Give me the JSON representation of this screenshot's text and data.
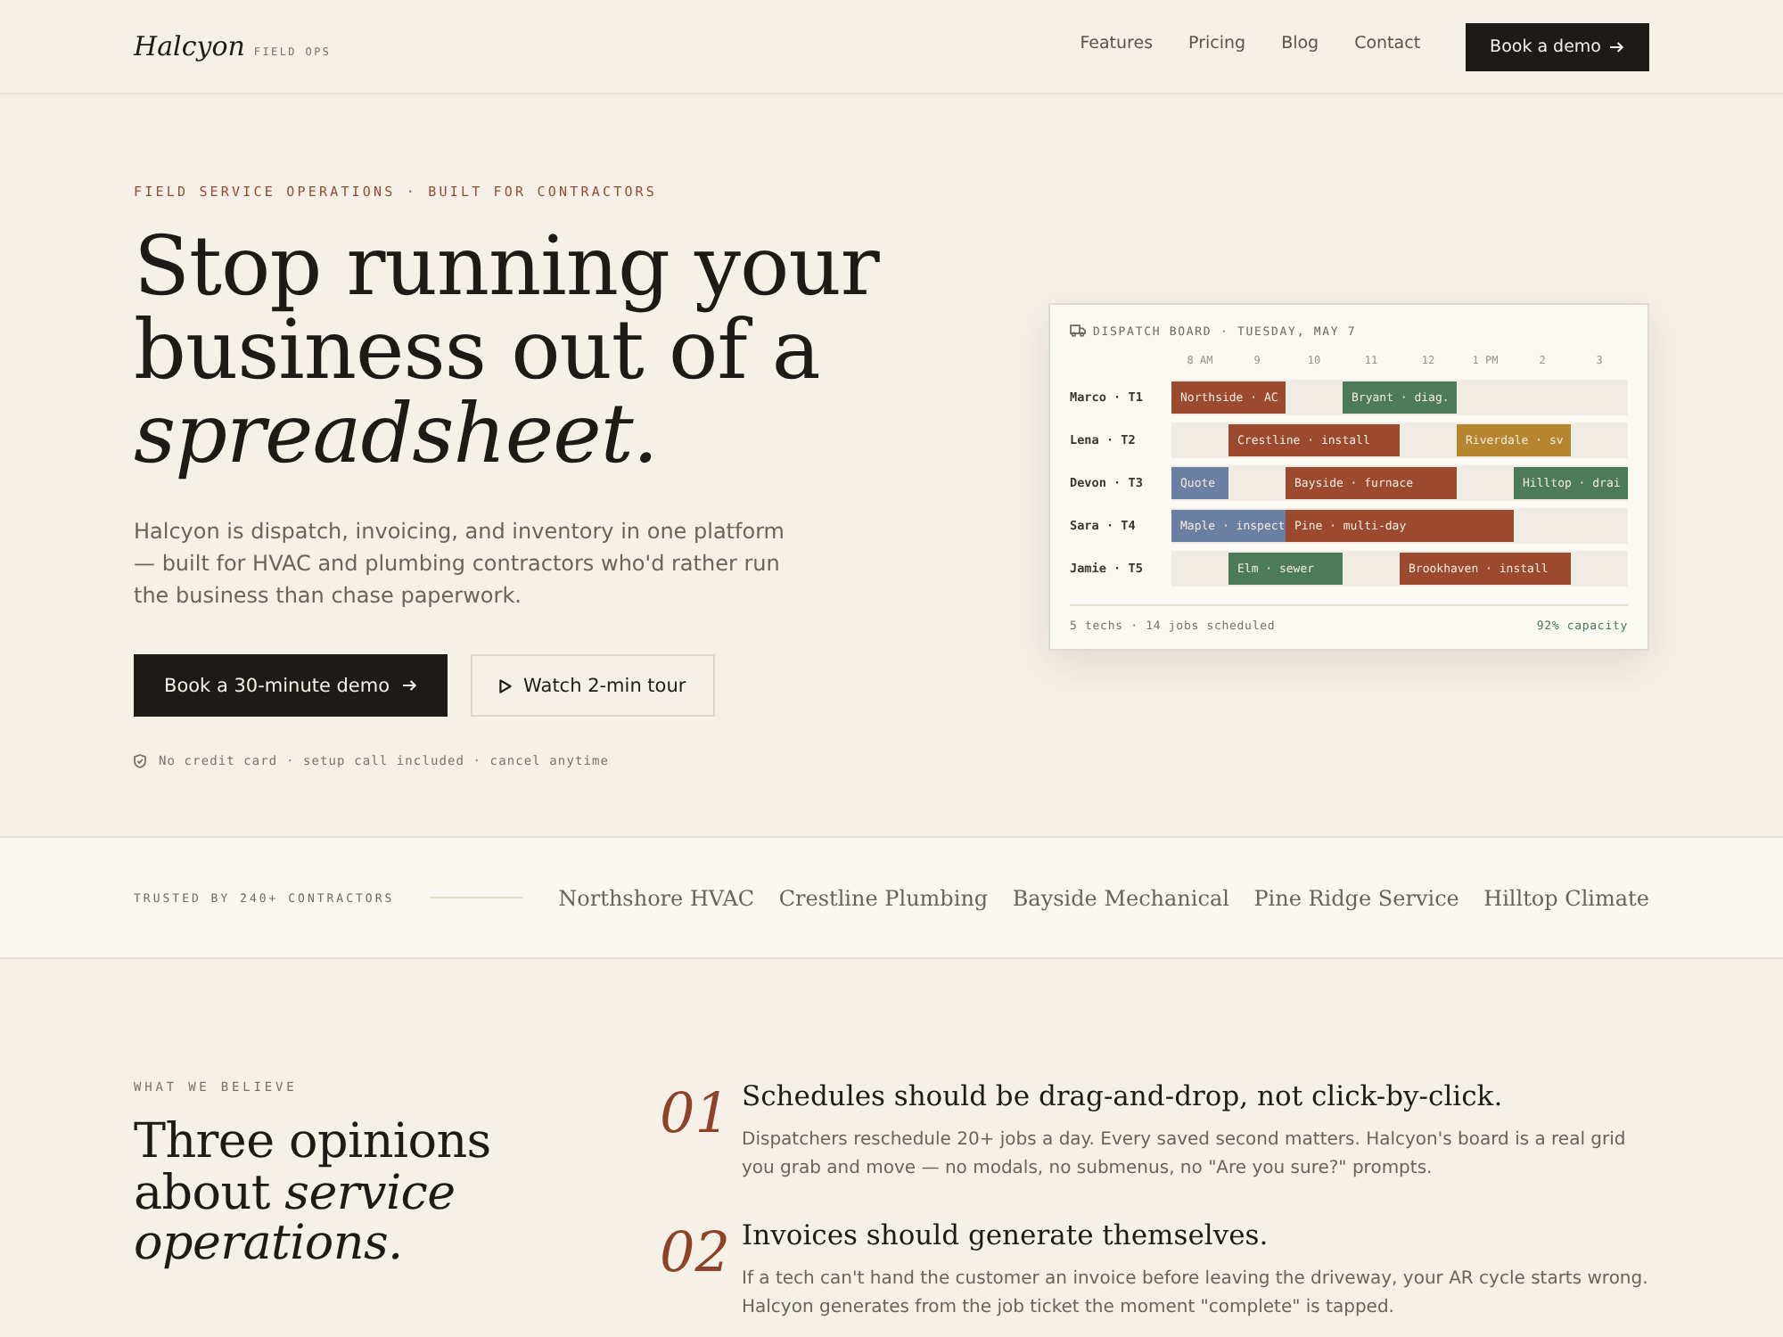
{
  "nav": {
    "logo": "Halcyon",
    "logo_tag": "FIELD OPS",
    "links": [
      "Features",
      "Pricing",
      "Blog",
      "Contact"
    ],
    "cta": "Book a demo"
  },
  "hero": {
    "eyebrow": "FIELD SERVICE OPERATIONS · BUILT FOR CONTRACTORS",
    "headline": "Stop running your business out of a *spreadsheet.*",
    "subtext": "Halcyon is dispatch, invoicing, and inventory in one platform — built for HVAC and plumbing contractors who'd rather run the business than chase paperwork.",
    "primary_button": "Book a 30-minute demo",
    "secondary_button": "Watch 2-min tour",
    "note": "No credit card · setup call included · cancel anytime"
  },
  "dispatch_board": {
    "title": "DISPATCH BOARD · TUESDAY, MAY 7",
    "hours": [
      "8 AM",
      "9",
      "10",
      "11",
      "12",
      "1 PM",
      "2",
      "3"
    ],
    "rows": [
      {
        "tech": "Marco · T1",
        "slots": [
          {
            "kind": "job",
            "label": "Northside · AC",
            "color": "#9b4a2f"
          },
          {
            "kind": "continued"
          },
          {
            "kind": "free"
          },
          {
            "kind": "job",
            "label": "Bryant · diag.",
            "color": "#4d7a57"
          },
          {
            "kind": "continued"
          },
          {
            "kind": "free"
          },
          {
            "kind": "free"
          },
          {
            "kind": "free"
          }
        ]
      },
      {
        "tech": "Lena · T2",
        "slots": [
          {
            "kind": "free"
          },
          {
            "kind": "job",
            "label": "Crestline · install",
            "color": "#9b4a2f"
          },
          {
            "kind": "continued"
          },
          {
            "kind": "continued"
          },
          {
            "kind": "free"
          },
          {
            "kind": "job",
            "label": "Riverdale · sv",
            "color": "#b5852f"
          },
          {
            "kind": "continued"
          },
          {
            "kind": "free"
          }
        ]
      },
      {
        "tech": "Devon · T3",
        "slots": [
          {
            "kind": "job",
            "label": "Quote",
            "color": "#6b7fa3"
          },
          {
            "kind": "free"
          },
          {
            "kind": "job",
            "label": "Bayside · furnace",
            "color": "#9b4a2f"
          },
          {
            "kind": "continued"
          },
          {
            "kind": "continued"
          },
          {
            "kind": "free"
          },
          {
            "kind": "job",
            "label": "Hilltop · drai",
            "color": "#4d7a57"
          },
          {
            "kind": "continued"
          }
        ]
      },
      {
        "tech": "Sara · T4",
        "slots": [
          {
            "kind": "job",
            "label": "Maple · inspect",
            "color": "#6b7fa3"
          },
          {
            "kind": "continued"
          },
          {
            "kind": "job",
            "label": "Pine · multi-day",
            "color": "#9b4a2f"
          },
          {
            "kind": "continued"
          },
          {
            "kind": "continued"
          },
          {
            "kind": "continued"
          },
          {
            "kind": "free"
          },
          {
            "kind": "free"
          }
        ]
      },
      {
        "tech": "Jamie · T5",
        "slots": [
          {
            "kind": "free"
          },
          {
            "kind": "job",
            "label": "Elm · sewer",
            "color": "#4d7a57"
          },
          {
            "kind": "continued"
          },
          {
            "kind": "free"
          },
          {
            "kind": "job",
            "label": "Brookhaven · install",
            "color": "#9b4a2f"
          },
          {
            "kind": "continued"
          },
          {
            "kind": "continued"
          },
          {
            "kind": "free"
          }
        ]
      }
    ],
    "summary": "5 techs · 14 jobs scheduled",
    "capacity": "92% capacity"
  },
  "trusted": {
    "label": "TRUSTED BY 240+ CONTRACTORS",
    "logos": [
      "Northshore HVAC",
      "Crestline Plumbing",
      "Bayside Mechanical",
      "Pine Ridge Service",
      "Hilltop Climate"
    ]
  },
  "beliefs": {
    "eyebrow": "WHAT WE BELIEVE",
    "heading": "Three opinions about *service operations.*",
    "items": [
      {
        "number": "01",
        "title": "Schedules should be drag-and-drop, not click-by-click.",
        "body": "Dispatchers reschedule 20+ jobs a day. Every saved second matters. Halcyon's board is a real grid you grab and move — no modals, no submenus, no \"Are you sure?\" prompts."
      },
      {
        "number": "02",
        "title": "Invoices should generate themselves.",
        "body": "If a tech can't hand the customer an invoice before leaving the driveway, your AR cycle starts wrong. Halcyon generates from the job ticket the moment \"complete\" is tapped."
      }
    ]
  }
}
